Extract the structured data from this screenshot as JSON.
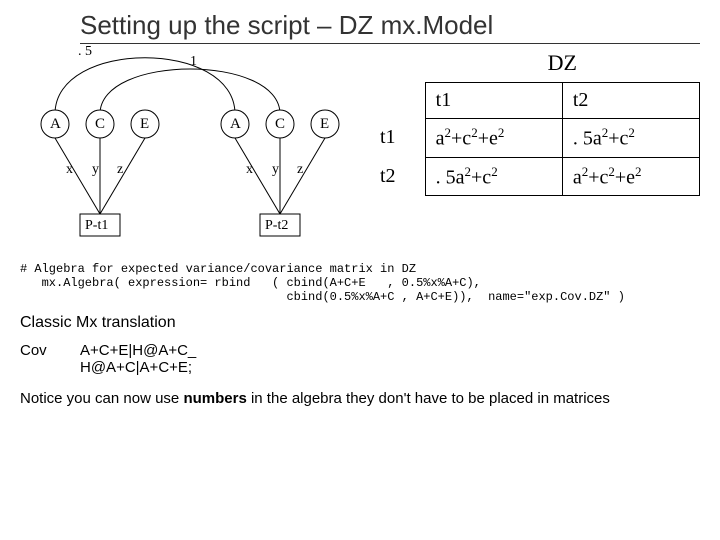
{
  "title": "Setting up the script – DZ mx.Model",
  "diagram": {
    "coef_left": ". 5",
    "coef_right": "1",
    "latent_left": [
      "A",
      "C",
      "E"
    ],
    "latent_right": [
      "A",
      "C",
      "E"
    ],
    "paths_left": [
      "x",
      "y",
      "z"
    ],
    "paths_right": [
      "x",
      "y",
      "z"
    ],
    "box_left": "P-t1",
    "box_right": "P-t2"
  },
  "table": {
    "title": "DZ",
    "col_headers": [
      "t1",
      "t2"
    ],
    "row_headers": [
      "t1",
      "t2"
    ],
    "cells": [
      [
        "a2+c2+e2",
        ". 5a2+c2"
      ],
      [
        ". 5a2+c2",
        "a2+c2+e2"
      ]
    ]
  },
  "algebra_code": "# Algebra for expected variance/covariance matrix in DZ\n   mx.Algebra( expression= rbind   ( cbind(A+C+E   , 0.5%x%A+C),\n                                     cbind(0.5%x%A+C , A+C+E)),  name=\"exp.Cov.DZ\" )",
  "mx_trans_head": "Classic Mx translation",
  "cov_label": "Cov",
  "cov_expr_l1": "A+C+E|H@A+C_",
  "cov_expr_l2": "H@A+C|A+C+E;",
  "notice_pre": "Notice you can now use ",
  "notice_bold": "numbers",
  "notice_post": " in the algebra they don't have to be placed in matrices"
}
